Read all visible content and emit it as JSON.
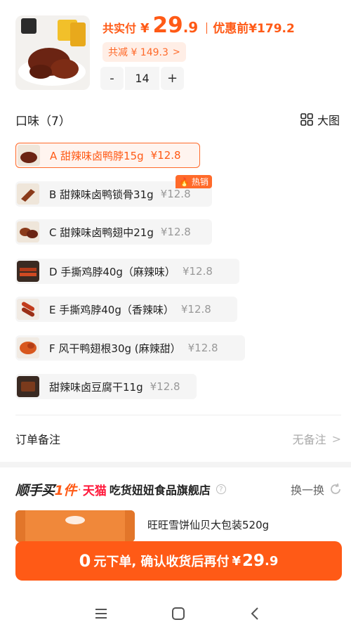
{
  "summary": {
    "total_label": "共实付",
    "currency": "¥",
    "price_int": "29",
    "price_dec": ".9",
    "original_label": "优惠前",
    "original_price": "¥179.2",
    "discount_text": "共减 ¥ 149.3",
    "discount_chevron": ">"
  },
  "quantity": {
    "minus": "-",
    "value": "14",
    "plus": "+"
  },
  "flavor": {
    "title": "口味（7）",
    "big_view_label": "大图",
    "hot_badge": "热销",
    "options": [
      {
        "name": "A 甜辣味卤鸭脖15g",
        "price": "¥12.8",
        "selected": true
      },
      {
        "name": "B 甜辣味卤鸭锁骨31g",
        "price": "¥12.8",
        "selected": false
      },
      {
        "name": "C 甜辣味卤鸭翅中21g",
        "price": "¥12.8",
        "selected": false
      },
      {
        "name": "D 手撕鸡脖40g（麻辣味）",
        "price": "¥12.8",
        "selected": false
      },
      {
        "name": "E 手撕鸡脖40g（香辣味）",
        "price": "¥12.8",
        "selected": false
      },
      {
        "name": "F 风干鸭翅根30g (麻辣甜）",
        "price": "¥12.8",
        "selected": false
      },
      {
        "name": "甜辣味卤豆腐干11g",
        "price": "¥12.8",
        "selected": false
      }
    ]
  },
  "remark": {
    "label": "订单备注",
    "value": "无备注",
    "chevron": ">"
  },
  "promo": {
    "logo_a": "顺手买",
    "logo_b": "1件",
    "dot": "·",
    "tmall": "天猫",
    "store": "吃货妞妞食品旗舰店",
    "help": "?",
    "refresh": "换一换",
    "product_name": "旺旺雪饼仙贝大包装520g"
  },
  "cta": {
    "big": "0",
    "text": "元下单, 确认收货后再付",
    "currency": "¥",
    "amount_int": "29",
    "amount_dec": ".9"
  },
  "colors": {
    "accent": "#ff5a16",
    "accent_light": "#fff4ef",
    "tmall": "#ff1a3c"
  },
  "icons": [
    "grid-icon",
    "chevron-right-icon",
    "refresh-icon",
    "help-icon",
    "fire-icon",
    "menu-icon",
    "home-icon",
    "back-icon"
  ]
}
